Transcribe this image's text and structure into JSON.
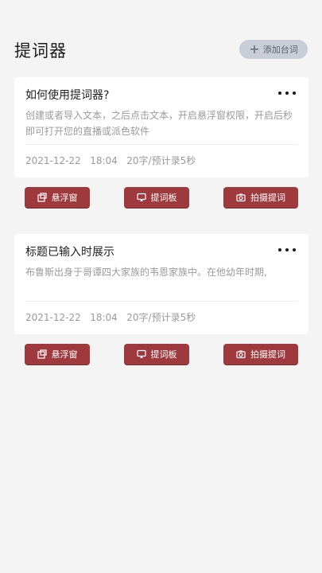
{
  "header": {
    "title": "提词器",
    "add_button_label": "添加台词"
  },
  "scripts": [
    {
      "title": "如何使用提词器?",
      "body": "创建或者导入文本，之后点击文本，开启悬浮窗权限，开启后秒即可打开您的直播或派色软件",
      "date": "2021-12-22",
      "time": "18:04",
      "stats": "20字/预计录5秒"
    },
    {
      "title": "标题已输入时展示",
      "body": "布鲁斯出身于哥谭四大家族的韦恩家族中。在他幼年时期,",
      "date": "2021-12-22",
      "time": "18:04",
      "stats": "20字/预计录5秒"
    }
  ],
  "actions": {
    "float_label": "悬浮窗",
    "board_label": "提词板",
    "shoot_label": "拍摄提词"
  },
  "colors": {
    "accent": "#9e3a3d",
    "background": "#f4f4f4",
    "add_button_bg": "#c9ced6"
  }
}
